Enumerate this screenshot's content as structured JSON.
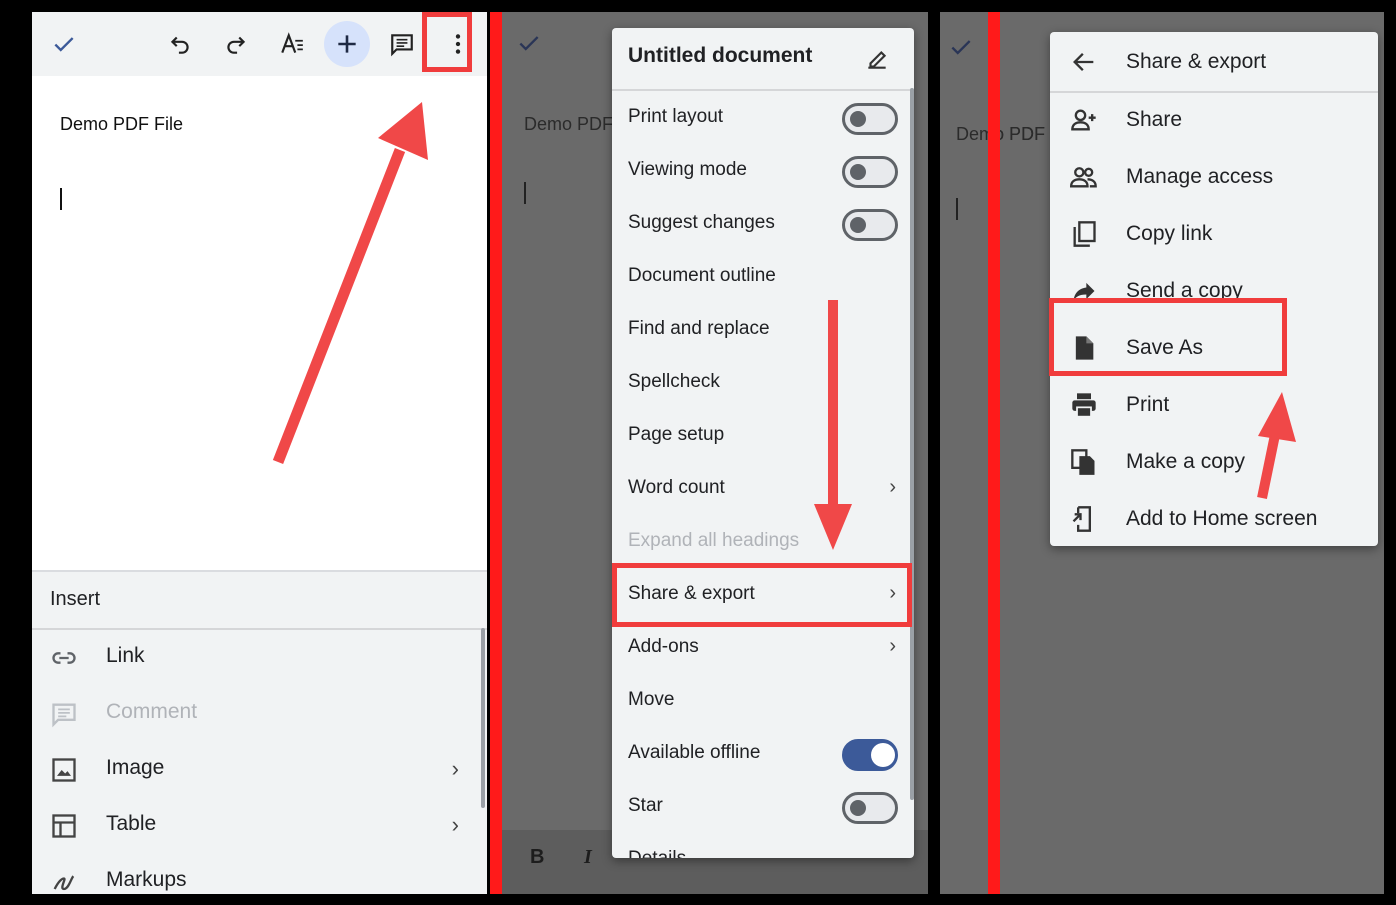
{
  "panel1": {
    "toolbar": {
      "check": "check-icon",
      "undo": "undo-icon",
      "redo": "redo-icon",
      "text_format": "text-format-icon",
      "insert": "plus-icon",
      "comment": "comment-icon",
      "more": "more-vert-icon"
    },
    "doc_text": "Demo PDF File",
    "insert_menu": {
      "title": "Insert",
      "items": [
        {
          "label": "Link",
          "icon": "link-icon",
          "enabled": true,
          "submenu": false
        },
        {
          "label": "Comment",
          "icon": "comment-icon",
          "enabled": false,
          "submenu": false
        },
        {
          "label": "Image",
          "icon": "image-icon",
          "enabled": true,
          "submenu": true
        },
        {
          "label": "Table",
          "icon": "table-icon",
          "enabled": true,
          "submenu": true
        },
        {
          "label": "Markups",
          "icon": "markup-icon",
          "enabled": true,
          "submenu": false
        }
      ]
    }
  },
  "panel2": {
    "doc_text": "Demo PDF",
    "menu": {
      "title": "Untitled document",
      "items": [
        {
          "label": "Print layout",
          "toggle": "off"
        },
        {
          "label": "Viewing mode",
          "toggle": "off"
        },
        {
          "label": "Suggest changes",
          "toggle": "off"
        },
        {
          "label": "Document outline"
        },
        {
          "label": "Find and replace"
        },
        {
          "label": "Spellcheck"
        },
        {
          "label": "Page setup"
        },
        {
          "label": "Word count",
          "submenu": true
        },
        {
          "label": "Expand all headings",
          "disabled": true
        },
        {
          "label": "Share & export",
          "submenu": true,
          "highlighted": true
        },
        {
          "label": "Add-ons",
          "submenu": true
        },
        {
          "label": "Move"
        },
        {
          "label": "Available offline",
          "toggle": "on"
        },
        {
          "label": "Star",
          "toggle": "off"
        },
        {
          "label": "Details"
        }
      ]
    },
    "format_bar": {
      "bold": "B",
      "italic": "I"
    }
  },
  "panel3": {
    "doc_text": "Demo PDF",
    "menu": {
      "title": "Share & export",
      "items": [
        {
          "label": "Share",
          "icon": "person-add-icon"
        },
        {
          "label": "Manage access",
          "icon": "people-icon"
        },
        {
          "label": "Copy link",
          "icon": "copy-icon"
        },
        {
          "label": "Send a copy",
          "icon": "send-icon"
        },
        {
          "label": "Save As",
          "icon": "file-icon",
          "highlighted": true
        },
        {
          "label": "Print",
          "icon": "print-icon"
        },
        {
          "label": "Make a copy",
          "icon": "duplicate-icon"
        },
        {
          "label": "Add to Home screen",
          "icon": "add-home-icon"
        }
      ]
    }
  },
  "colors": {
    "annotation": "#f03c3c",
    "separator": "#ff1a1a",
    "toggle_on": "#3c5a99",
    "accent": "#1a73e8"
  }
}
